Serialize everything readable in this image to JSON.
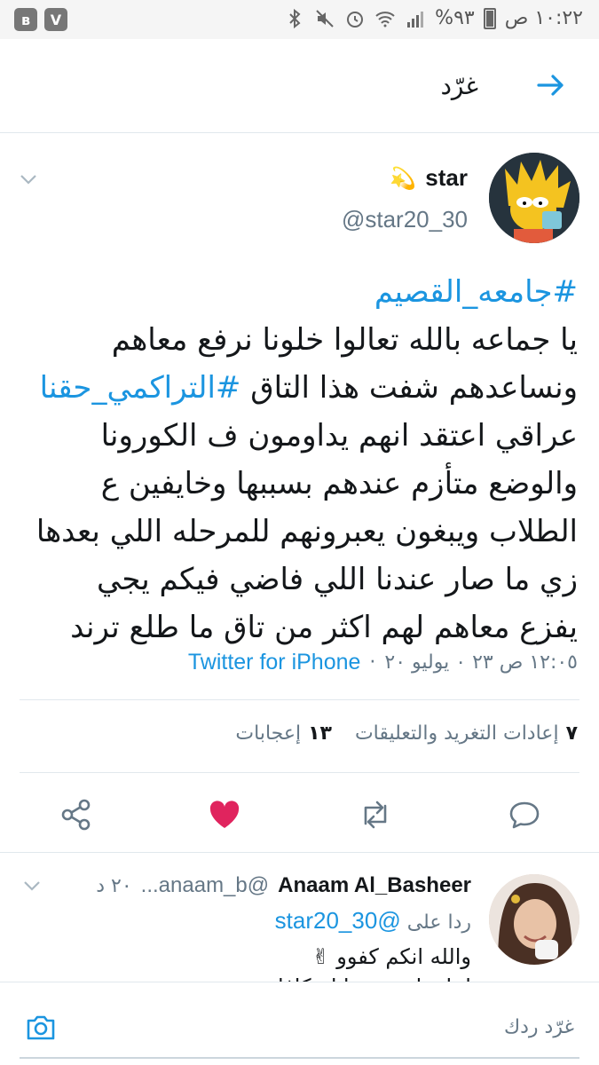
{
  "status_bar": {
    "time": "١٠:٢٢ ص",
    "battery": "%٩٣",
    "icons": [
      "battery-icon",
      "signal-icon",
      "wifi-icon",
      "alarm-icon",
      "mute-icon",
      "bluetooth-icon"
    ],
    "app_badges": [
      "bluetooth-badge",
      "v-badge"
    ],
    "v_badge_label": "V",
    "bt_badge_label": "ʙ"
  },
  "header": {
    "title": "غرّد",
    "back_icon": "arrow-right-icon"
  },
  "tweet": {
    "name": "star",
    "name_emoji": "💫",
    "handle": "@star20_30",
    "lines": [
      {
        "hashtag": "#جامعه_القصيم"
      },
      {
        "text": "يا جماعه بالله تعالوا خلونا نرفع معاهم"
      },
      {
        "text": "ونساعدهم شفت هذا التاق ",
        "hashtag": "#التراكمي_حقنا"
      },
      {
        "text": "عراقي اعتقد انهم يداومون ف الكورونا"
      },
      {
        "text": "والوضع متأزم عندهم بسببها وخايفين ع"
      },
      {
        "text": "الطلاب ويبغون يعبرونهم للمرحله اللي بعدها"
      },
      {
        "text": "زي ما صار عندنا اللي فاضي فيكم يجي"
      },
      {
        "text": "يفزع معاهم لهم اكثر من تاق ما طلع ترند"
      }
    ],
    "timestamp": "١٢:٠٥ ص ٢٣ ٠ يوليو ٢٠",
    "dot": "·",
    "source": "Twitter for iPhone",
    "stats": {
      "retweets_count": "٧",
      "retweets_label": "إعادات التغريد والتعليقات",
      "likes_count": "١٣",
      "likes_label": "إعجابات"
    }
  },
  "reply": {
    "name": "Anaam Al_Basheer",
    "handle": "@anaam_b...",
    "time": "٢٠ د",
    "replying_label": "ردا على",
    "replying_to": "@star20_30",
    "text": "والله انكم كفوو ✌",
    "text_partial": "لمابة اسع سمانا مكافا"
  },
  "compose": {
    "placeholder": "غرّد ردك"
  },
  "colors": {
    "accent": "#1b95e0",
    "like": "#e0245e",
    "muted": "#657786"
  }
}
